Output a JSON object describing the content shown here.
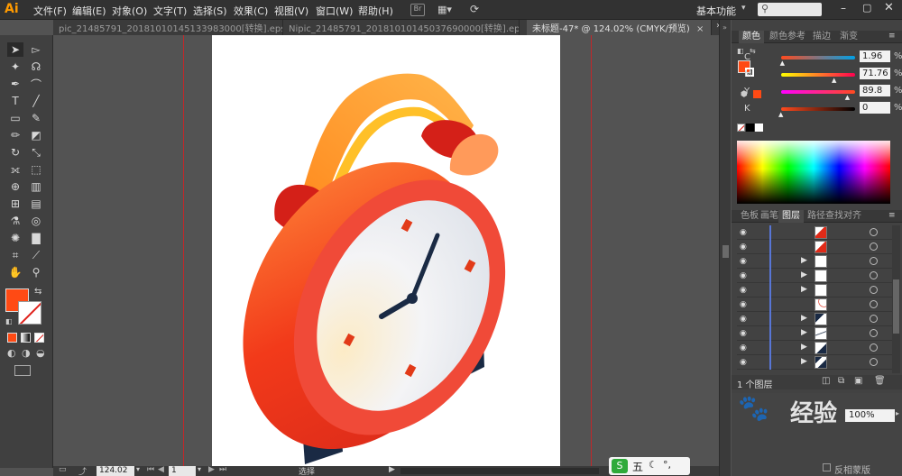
{
  "app": {
    "logo": "Ai",
    "menus": [
      "文件(F)",
      "编辑(E)",
      "对象(O)",
      "文字(T)",
      "选择(S)",
      "效果(C)",
      "视图(V)",
      "窗口(W)",
      "帮助(H)"
    ],
    "workspace": "基本功能",
    "search_placeholder": ""
  },
  "tabs": [
    {
      "label": "pic_21485791_20181010145133983000[转换].eps*",
      "active": false
    },
    {
      "label": "Nipic_21485791_20181010145037690000[转换].eps*",
      "active": false
    },
    {
      "label": "未标题-47* @ 124.02% (CMYK/预览)",
      "active": true
    }
  ],
  "color_panel": {
    "tabs": [
      "颜色",
      "颜色参考",
      "描边",
      "渐变"
    ],
    "active_tab": "颜色",
    "sliders": [
      {
        "label": "C",
        "value": "1.96",
        "fraction": 0.02,
        "gradient": "linear-gradient(90deg,#ff4a1e,#00a0e6)"
      },
      {
        "label": "M",
        "value": "71.76",
        "fraction": 0.72,
        "gradient": "linear-gradient(90deg,#ffff00,#ff0050)"
      },
      {
        "label": "Y",
        "value": "89.8",
        "fraction": 0.9,
        "gradient": "linear-gradient(90deg,#ff00ff,#ff4a1e)"
      },
      {
        "label": "K",
        "value": "0",
        "fraction": 0.0,
        "gradient": "linear-gradient(90deg,#ff4a1e,#000000)"
      }
    ],
    "percent": "%",
    "fill_color": "#ff4a14"
  },
  "layers_panel": {
    "tabs": [
      "色板",
      "画笔",
      "图层",
      "路径查找",
      "对齐"
    ],
    "active_tab": "图层",
    "rows": [
      {
        "expandable": false
      },
      {
        "expandable": false
      },
      {
        "expandable": true
      },
      {
        "expandable": true
      },
      {
        "expandable": true
      },
      {
        "expandable": false
      },
      {
        "expandable": true
      },
      {
        "expandable": true
      },
      {
        "expandable": true
      },
      {
        "expandable": true
      }
    ],
    "footer_label": "1 个图层",
    "lower_value": "100%",
    "lower_toggle": "反相蒙版"
  },
  "statusbar": {
    "zoom": "124.02",
    "artboard": "1",
    "tool_label": "选择"
  },
  "watermark": {
    "ime_label": "五",
    "brand": "经验"
  }
}
